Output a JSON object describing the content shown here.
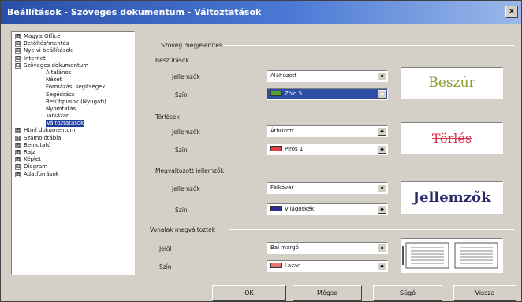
{
  "window": {
    "title": "Beállítások - Szöveges dokumentum - Változtatások",
    "close_glyph": "✕"
  },
  "tree": [
    {
      "label": "MagyarOffice",
      "level": 0,
      "expander": "⊞",
      "selected": false
    },
    {
      "label": "Betöltés/mentés",
      "level": 0,
      "expander": "⊞",
      "selected": false
    },
    {
      "label": "Nyelvi beállítások",
      "level": 0,
      "expander": "⊞",
      "selected": false
    },
    {
      "label": "Internet",
      "level": 0,
      "expander": "⊞",
      "selected": false
    },
    {
      "label": "Szöveges dokumentum",
      "level": 0,
      "expander": "⊟",
      "selected": false
    },
    {
      "label": "Általános",
      "level": 1,
      "expander": "",
      "selected": false
    },
    {
      "label": "Nézet",
      "level": 1,
      "expander": "",
      "selected": false
    },
    {
      "label": "Formázási segítségek",
      "level": 1,
      "expander": "",
      "selected": false
    },
    {
      "label": "Segédrács",
      "level": 1,
      "expander": "",
      "selected": false
    },
    {
      "label": "Betűtípusok (Nyugati)",
      "level": 1,
      "expander": "",
      "selected": false
    },
    {
      "label": "Nyomtatás",
      "level": 1,
      "expander": "",
      "selected": false
    },
    {
      "label": "Táblázat",
      "level": 1,
      "expander": "",
      "selected": false
    },
    {
      "label": "Változtatások",
      "level": 1,
      "expander": "",
      "selected": true
    },
    {
      "label": "Html dokumentum",
      "level": 0,
      "expander": "⊞",
      "selected": false
    },
    {
      "label": "Számolótábla",
      "level": 0,
      "expander": "⊞",
      "selected": false
    },
    {
      "label": "Bemutató",
      "level": 0,
      "expander": "⊞",
      "selected": false
    },
    {
      "label": "Rajz",
      "level": 0,
      "expander": "⊞",
      "selected": false
    },
    {
      "label": "Képlet",
      "level": 0,
      "expander": "⊞",
      "selected": false
    },
    {
      "label": "Diagram",
      "level": 0,
      "expander": "⊞",
      "selected": false
    },
    {
      "label": "Adatforrások",
      "level": 0,
      "expander": "⊞",
      "selected": false
    }
  ],
  "panel": {
    "section_title": "Szöveg megjelenítés",
    "insertions": {
      "title": "Beszúrások",
      "attr_label": "Jellemzők",
      "attr_value": "Aláhúzott",
      "color_label": "Szín",
      "color_value": "Zöld 5",
      "color_hex": "#5aa02c",
      "preview": "Beszúr",
      "preview_color": "#8a9a2a"
    },
    "deletions": {
      "title": "Törlések",
      "attr_label": "Jellemzők",
      "attr_value": "Áthúzott",
      "color_label": "Szín",
      "color_value": "Piros 1",
      "color_hex": "#e0404a",
      "preview": "Törlés",
      "preview_color": "#d8354a"
    },
    "changed_attrs": {
      "title": "Megváltozott jellemzők",
      "attr_label": "Jellemzők",
      "attr_value": "Félkövér",
      "color_label": "Szín",
      "color_value": "Világoskék",
      "color_hex": "#2e2e8c",
      "preview": "Jellemzők",
      "preview_color": "#2a2a6a"
    },
    "changed_lines": {
      "title": "Vonalak megváltoztak",
      "mark_label": "Jelöl",
      "mark_value": "Bal margó",
      "color_label": "Szín",
      "color_value": "Lazac",
      "color_hex": "#e87a6a"
    }
  },
  "combo_arrow": "◆",
  "buttons": {
    "ok": "OK",
    "cancel": "Mégse",
    "help": "Súgó",
    "back": "Vissza"
  }
}
